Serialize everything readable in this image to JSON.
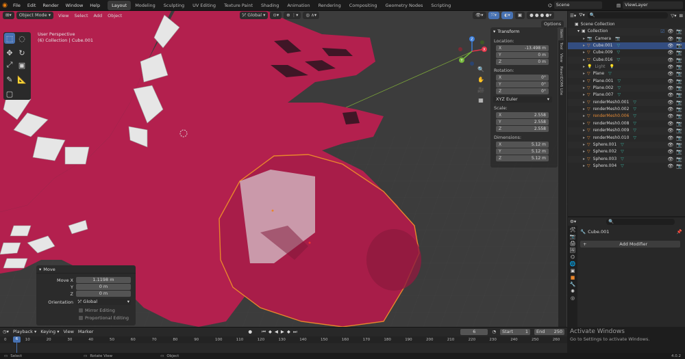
{
  "menu": [
    "File",
    "Edit",
    "Render",
    "Window",
    "Help"
  ],
  "workspaces": [
    {
      "label": "Layout",
      "active": true
    },
    {
      "label": "Modeling"
    },
    {
      "label": "Sculpting"
    },
    {
      "label": "UV Editing"
    },
    {
      "label": "Texture Paint"
    },
    {
      "label": "Shading"
    },
    {
      "label": "Animation"
    },
    {
      "label": "Rendering"
    },
    {
      "label": "Compositing"
    },
    {
      "label": "Geometry Nodes"
    },
    {
      "label": "Scripting"
    }
  ],
  "scene": "Scene",
  "view_layer": "ViewLayer",
  "viewport": {
    "mode": "Object Mode",
    "menus": [
      "View",
      "Select",
      "Add",
      "Object"
    ],
    "transform_orientation": "Global",
    "options": "Options",
    "perspective_label": "User Perspective",
    "context_label": "(6) Collection | Cube.001",
    "gizmo_axes": [
      "X",
      "Y",
      "Z"
    ]
  },
  "n_panel": {
    "title": "Transform",
    "location_label": "Location:",
    "location": [
      {
        "axis": "X",
        "value": "-13.498 m"
      },
      {
        "axis": "Y",
        "value": "0 m"
      },
      {
        "axis": "Z",
        "value": "0 m"
      }
    ],
    "rotation_label": "Rotation:",
    "rotation": [
      {
        "axis": "X",
        "value": "0°"
      },
      {
        "axis": "Y",
        "value": "0°"
      },
      {
        "axis": "Z",
        "value": "0°"
      }
    ],
    "rotation_mode": "XYZ Euler",
    "scale_label": "Scale:",
    "scale": [
      {
        "axis": "X",
        "value": "2.558"
      },
      {
        "axis": "Y",
        "value": "2.558"
      },
      {
        "axis": "Z",
        "value": "2.558"
      }
    ],
    "dimensions_label": "Dimensions:",
    "dimensions": [
      {
        "axis": "X",
        "value": "5.12 m"
      },
      {
        "axis": "Y",
        "value": "5.12 m"
      },
      {
        "axis": "Z",
        "value": "5.12 m"
      }
    ],
    "tabs": [
      "Item",
      "Tool",
      "View",
      "ReactDOMi Lite"
    ]
  },
  "operator_panel": {
    "title": "Move",
    "move_x_label": "Move X",
    "move_x": "1.1198 m",
    "y_label": "Y",
    "y": "0 m",
    "z_label": "Z",
    "z": "0 m",
    "orientation_label": "Orientation",
    "orientation": "Global",
    "mirror_editing": "Mirror Editing",
    "proportional_editing": "Proportional Editing"
  },
  "outliner": {
    "root": "Scene Collection",
    "collection": "Collection",
    "items": [
      {
        "name": "Camera",
        "type": "camera"
      },
      {
        "name": "Cube.001",
        "type": "mesh",
        "selected": true
      },
      {
        "name": "Cube.009",
        "type": "mesh"
      },
      {
        "name": "Cube.016",
        "type": "mesh"
      },
      {
        "name": "Light",
        "type": "light"
      },
      {
        "name": "Plane",
        "type": "mesh"
      },
      {
        "name": "Plane.001",
        "type": "mesh"
      },
      {
        "name": "Plane.002",
        "type": "mesh"
      },
      {
        "name": "Plane.007",
        "type": "mesh"
      },
      {
        "name": "renderMesh0.001",
        "type": "mesh"
      },
      {
        "name": "renderMesh0.002",
        "type": "mesh"
      },
      {
        "name": "renderMesh0.006",
        "type": "mesh",
        "highlighted": true
      },
      {
        "name": "renderMesh0.008",
        "type": "mesh"
      },
      {
        "name": "renderMesh0.009",
        "type": "mesh"
      },
      {
        "name": "renderMesh0.010",
        "type": "mesh"
      },
      {
        "name": "Sphere.001",
        "type": "mesh"
      },
      {
        "name": "Sphere.002",
        "type": "mesh"
      },
      {
        "name": "Sphere.003",
        "type": "mesh"
      },
      {
        "name": "Sphere.004",
        "type": "mesh"
      }
    ]
  },
  "properties": {
    "object_name": "Cube.001",
    "add_modifier": "Add Modifier"
  },
  "timeline": {
    "menus": [
      "Playback",
      "Keying",
      "View",
      "Marker"
    ],
    "current_frame": "6",
    "start_label": "Start",
    "start": "1",
    "end_label": "End",
    "end": "250",
    "ticks": [
      "0",
      "10",
      "20",
      "30",
      "40",
      "50",
      "60",
      "70",
      "80",
      "90",
      "100",
      "110",
      "120",
      "130",
      "140",
      "150",
      "160",
      "170",
      "180",
      "190",
      "200",
      "210",
      "220",
      "230",
      "240",
      "250",
      "260"
    ]
  },
  "status_bar": {
    "left": "Select",
    "middle": "Rotate View",
    "right": "Object",
    "version": "4.0.2"
  },
  "watermark": {
    "title": "Activate Windows",
    "subtitle": "Go to Settings to activate Windows."
  },
  "colors": {
    "mesh": "#b3204e",
    "selection_outline": "#e8862c",
    "accent": "#4772b3",
    "background": "#3a3a3a"
  }
}
